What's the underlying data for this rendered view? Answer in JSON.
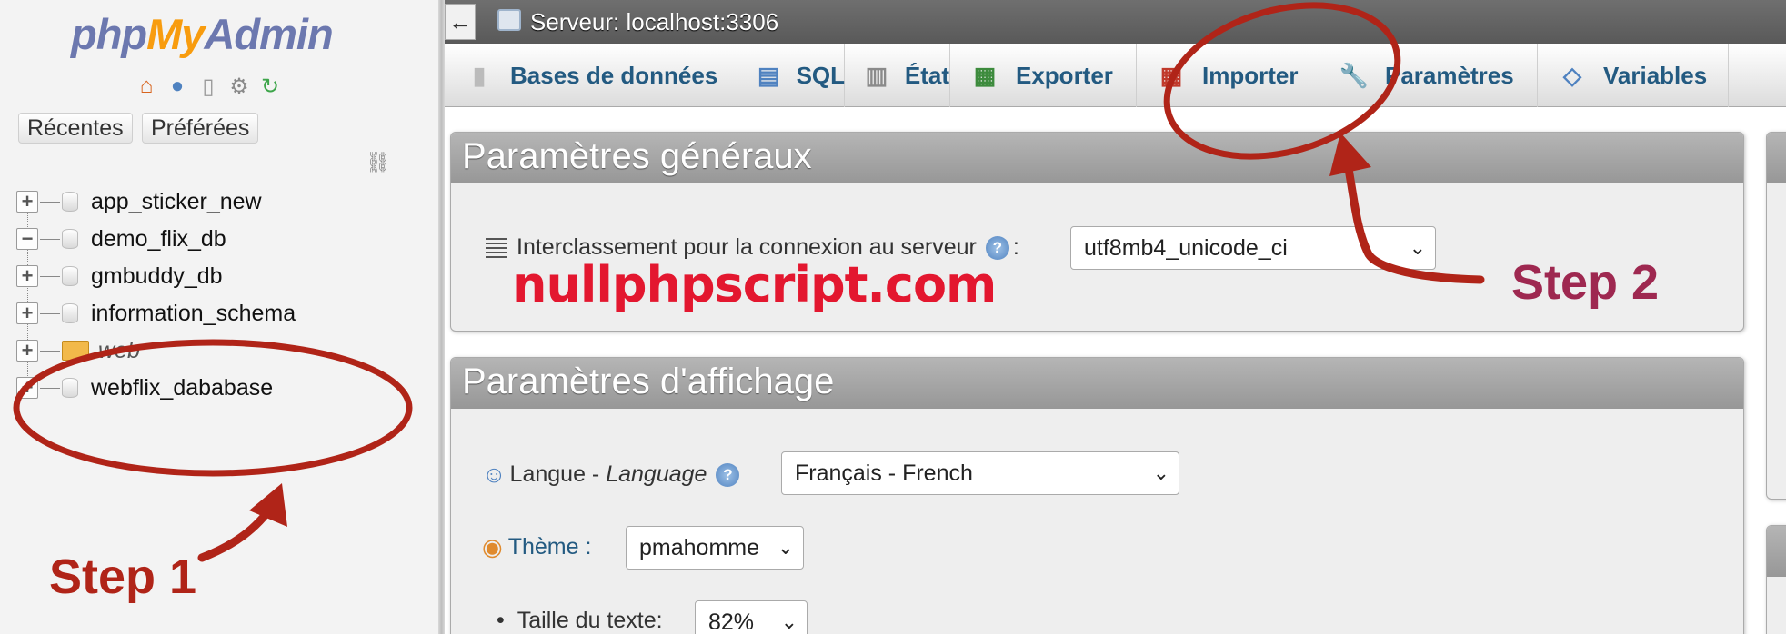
{
  "nav": {
    "logo": {
      "php": "php",
      "my": "My",
      "admin": "Admin"
    },
    "recent_label": "Récentes",
    "favorites_label": "Préférées",
    "databases": [
      {
        "name": "app_sticker_new",
        "expander": "+",
        "italic": false
      },
      {
        "name": "demo_flix_db",
        "expander": "−",
        "italic": false
      },
      {
        "name": "gmbuddy_db",
        "expander": "+",
        "italic": false
      },
      {
        "name": "information_schema",
        "expander": "+",
        "italic": false
      },
      {
        "name": "web",
        "expander": "+",
        "italic": true
      },
      {
        "name": "webflix_dababase",
        "expander": "+",
        "italic": false
      }
    ]
  },
  "topbar": {
    "back_symbol": "←",
    "server_label": "Serveur: localhost:3306"
  },
  "tabs": [
    {
      "label": "Bases de données",
      "icon": "database-icon"
    },
    {
      "label": "SQL",
      "icon": "sql-icon"
    },
    {
      "label": "État",
      "icon": "status-icon"
    },
    {
      "label": "Exporter",
      "icon": "export-icon"
    },
    {
      "label": "Importer",
      "icon": "import-icon"
    },
    {
      "label": "Paramètres",
      "icon": "wrench-icon"
    },
    {
      "label": "Variables",
      "icon": "variables-icon"
    }
  ],
  "general": {
    "title": "Paramètres généraux",
    "collation_label": "Interclassement pour la connexion au serveur",
    "collation_colon": ":",
    "collation_value": "utf8mb4_unicode_ci"
  },
  "display": {
    "title": "Paramètres d'affichage",
    "language_label": "Langue - ",
    "language_label_italic": "Language",
    "language_value": "Français - French",
    "theme_label": "Thème :",
    "theme_value": "pmahomme",
    "font_size_label": "Taille du texte:",
    "font_size_value": "82%"
  },
  "watermark": "nullphpscript.com",
  "annotations": {
    "step1": "Step 1",
    "step2": "Step 2",
    "step1_color": "#b02418",
    "step2_color": "#9e2850",
    "circle_color": "#b02418"
  },
  "colors": {
    "tab_text": "#235a81",
    "watermark": "#e3172f",
    "logo_blue": "#6c78af",
    "logo_orange": "#f89c0e"
  }
}
